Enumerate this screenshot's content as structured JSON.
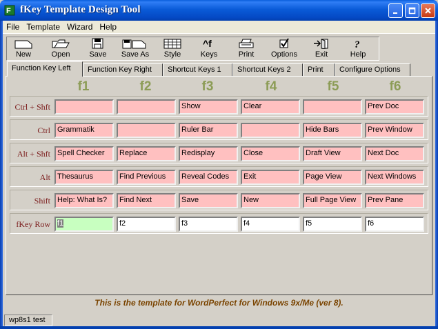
{
  "window": {
    "title": "fKey Template Design Tool"
  },
  "menu": [
    "File",
    "Template",
    "Wizard",
    "Help"
  ],
  "toolbar": [
    {
      "label": "New",
      "icon": "new-icon"
    },
    {
      "label": "Open",
      "icon": "open-icon"
    },
    {
      "label": "Save",
      "icon": "save-icon"
    },
    {
      "label": "Save As",
      "icon": "save-as-icon"
    },
    {
      "label": "Style",
      "icon": "style-icon"
    },
    {
      "label": "Keys",
      "icon": "keys-icon"
    },
    {
      "label": "Print",
      "icon": "print-icon"
    },
    {
      "label": "Options",
      "icon": "options-icon"
    },
    {
      "label": "Exit",
      "icon": "exit-icon"
    },
    {
      "label": "Help",
      "icon": "help-icon"
    }
  ],
  "tabs": [
    {
      "label": "Function Key Left",
      "active": true
    },
    {
      "label": "Function Key Right",
      "active": false
    },
    {
      "label": "Shortcut Keys 1",
      "active": false
    },
    {
      "label": "Shortcut Keys 2",
      "active": false
    },
    {
      "label": "Print",
      "active": false
    },
    {
      "label": "Configure Options",
      "active": false
    }
  ],
  "grid": {
    "columns": [
      "f1",
      "f2",
      "f3",
      "f4",
      "f5",
      "f6"
    ],
    "rows": [
      {
        "label": "Ctrl + Shft",
        "cells": [
          "",
          "",
          "Show",
          "Clear",
          "",
          "Prev Doc"
        ]
      },
      {
        "label": "Ctrl",
        "cells": [
          "Grammatik",
          "",
          "Ruler Bar",
          "",
          "Hide Bars",
          "Prev Window"
        ]
      },
      {
        "label": "Alt + Shft",
        "cells": [
          "Spell Checker",
          "Replace",
          "Redisplay",
          "Close",
          "Draft View",
          "Next Doc"
        ]
      },
      {
        "label": "Alt",
        "cells": [
          "Thesaurus",
          "Find Previous",
          "Reveal Codes",
          "Exit",
          "Page View",
          "Next Windows"
        ]
      },
      {
        "label": "Shift",
        "cells": [
          "Help: What Is?",
          "Find Next",
          "Save",
          "New",
          "Full Page View",
          "Prev Pane"
        ]
      },
      {
        "label": "fKey Row",
        "cells": [
          "f1",
          "f2",
          "f3",
          "f4",
          "f5",
          "f6"
        ]
      }
    ]
  },
  "footer": {
    "message": "This is the template for WordPerfect for Windows 9x/Me  (ver 8)."
  },
  "status": {
    "text": "wp8s1 test"
  },
  "colors": {
    "cell_bg": "#ffc0c0",
    "selected_cell_bg": "#c8ffc0",
    "header_color": "#8c9c56",
    "row_label_color": "#7a1a1a",
    "footer_color": "#7a4400"
  }
}
